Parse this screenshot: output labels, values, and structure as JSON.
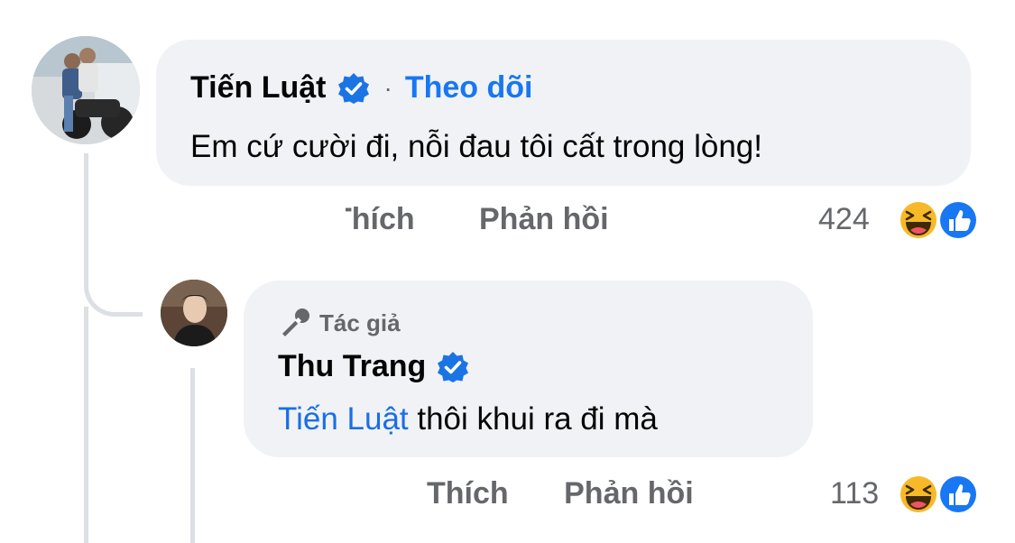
{
  "comment": {
    "author": "Tiến Luật",
    "follow_label": "Theo dõi",
    "separator": "·",
    "text": "Em cứ cười đi, nỗi đau tôi cất trong lòng!",
    "like_label": "Thích",
    "reply_label": "Phản hồi",
    "reaction_count": "424",
    "reactions": [
      "haha-icon",
      "like-icon"
    ]
  },
  "reply": {
    "author_tag": "Tác giả",
    "author": "Thu Trang",
    "mention": "Tiến Luật",
    "text": " thôi khui ra đi mà",
    "like_label": "Thích",
    "reply_label": "Phản hồi",
    "reaction_count": "113",
    "reactions": [
      "haha-icon",
      "like-icon"
    ]
  },
  "colors": {
    "bubble": "#f0f2f5",
    "link_blue": "#1877f2",
    "verified_blue": "#1b74e4",
    "secondary_text": "#65676b",
    "thread_line": "#dcdfe3"
  }
}
